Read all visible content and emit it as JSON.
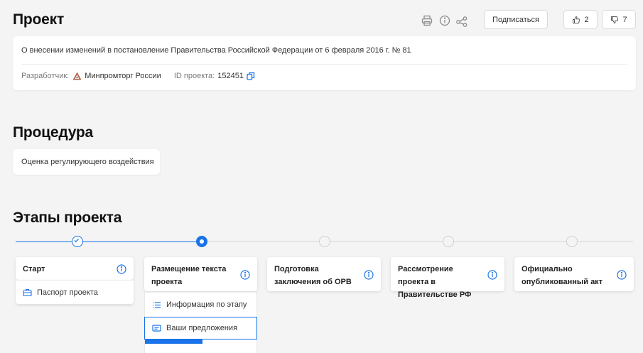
{
  "project": {
    "title": "Проект",
    "subscribe_label": "Подписаться",
    "likes": "2",
    "dislikes": "7",
    "description": "О внесении изменений в постановление Правительства Российской Федерации от 6 февраля 2016 г. № 81",
    "developer_label": "Разработчик:",
    "developer_name": "Минпромторг России",
    "id_label": "ID проекта:",
    "id_value": "152451"
  },
  "procedure": {
    "title": "Процедура",
    "value": "Оценка регулирующего воздействия"
  },
  "stages": {
    "title": "Этапы проекта",
    "items": [
      {
        "label": "Старт",
        "status": "done"
      },
      {
        "label": "Размещение текста проекта",
        "status": "current"
      },
      {
        "label": "Подготовка заключения об ОРВ",
        "status": "pending"
      },
      {
        "label": "Рассмотрение проекта в Правительстве РФ",
        "status": "pending"
      },
      {
        "label": "Официально опубликованный акт",
        "status": "pending"
      }
    ],
    "start_links": [
      "Паспорт проекта"
    ],
    "current_links": [
      "Информация по этапу",
      "Ваши предложения"
    ]
  },
  "colors": {
    "accent": "#1a73e8",
    "background": "#f4f4f4",
    "pending_dot": "#d0d0d0",
    "developer_logo": "#b5634a"
  }
}
